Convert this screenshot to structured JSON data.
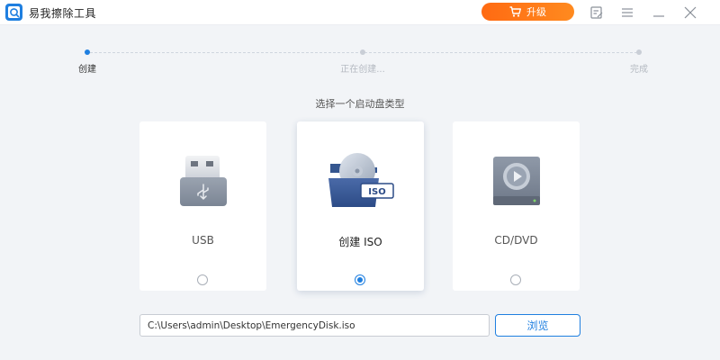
{
  "app": {
    "title": "易我擦除工具",
    "upgrade_label": "升级"
  },
  "steps": [
    {
      "label": "创建",
      "active": true
    },
    {
      "label": "正在创建...",
      "active": false
    },
    {
      "label": "完成",
      "active": false
    }
  ],
  "subtitle": "选择一个启动盘类型",
  "cards": [
    {
      "label": "USB",
      "icon": "usb-drive-icon",
      "selected": false
    },
    {
      "label": "创建 ISO",
      "icon": "iso-folder-icon",
      "selected": true
    },
    {
      "label": "CD/DVD",
      "icon": "cd-dvd-drive-icon",
      "selected": false
    }
  ],
  "iso_badge": "ISO",
  "path": {
    "value": "C:\\Users\\admin\\Desktop\\EmergencyDisk.iso"
  },
  "browse_label": "浏览",
  "colors": {
    "accent": "#1f7fe0",
    "upgrade": "#ff7a1a",
    "background": "#f2f4f7"
  }
}
